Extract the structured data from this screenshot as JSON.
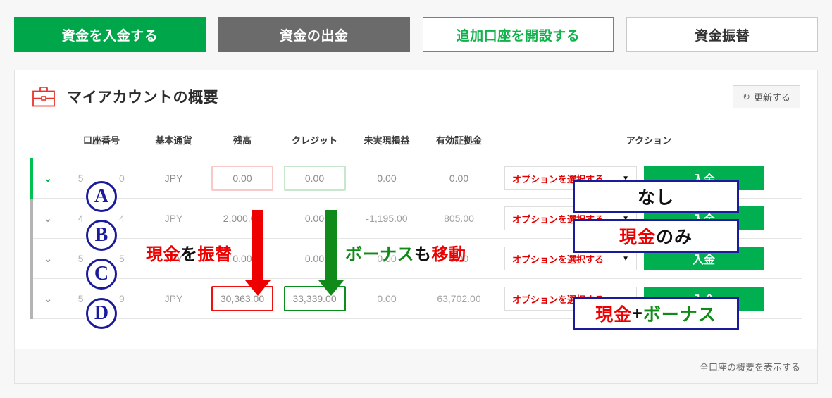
{
  "topbar": {
    "deposit_label": "資金を入金する",
    "withdraw_label": "資金の出金",
    "new_account_label": "追加口座を開設する",
    "transfer_label": "資金振替"
  },
  "card": {
    "icon": "briefcase-icon",
    "title": "マイアカウントの概要",
    "refresh_icon": "↻",
    "refresh_label": "更新する",
    "footer_link": "全口座の概要を表示する"
  },
  "table": {
    "headers": {
      "mark": "",
      "account": "口座番号",
      "currency": "基本通貨",
      "balance": "残高",
      "credit": "クレジット",
      "unrealized": "未実現損益",
      "equity": "有効証拠金",
      "action": "アクション"
    },
    "rows": [
      {
        "marker": "A",
        "chevron": "⌄",
        "account_prefix": "5",
        "account_suffix": "0",
        "currency": "JPY",
        "balance": "0.00",
        "credit": "0.00",
        "unrealized": "0.00",
        "equity": "0.00",
        "option_label": "オプションを選択する",
        "caret": "▼",
        "deposit_label": "入金"
      },
      {
        "marker": "B",
        "chevron": "⌄",
        "account_prefix": "4",
        "account_suffix": "4",
        "currency": "JPY",
        "balance": "2,000.00",
        "credit": "0.00",
        "unrealized": "-1,195.00",
        "equity": "805.00",
        "option_label": "オプションを選択する",
        "caret": "▼",
        "deposit_label": "入金"
      },
      {
        "marker": "C",
        "chevron": "⌄",
        "account_prefix": "5",
        "account_suffix": "5",
        "currency": "JPY",
        "balance": "0.00",
        "credit": "0.00",
        "unrealized": "0.00",
        "equity": "0.00",
        "option_label": "オプションを選択する",
        "caret": "▼",
        "deposit_label": "入金"
      },
      {
        "marker": "D",
        "chevron": "⌄",
        "account_prefix": "5",
        "account_suffix": "9",
        "currency": "JPY",
        "balance": "30,363.00",
        "credit": "33,339.00",
        "unrealized": "0.00",
        "equity": "63,702.00",
        "option_label": "オプションを選択する",
        "caret": "▼",
        "deposit_label": "入金"
      }
    ]
  },
  "annotations": {
    "markers": [
      "A",
      "B",
      "C",
      "D"
    ],
    "note_a": {
      "text": "なし"
    },
    "note_b": {
      "part1": "現金",
      "part2": "のみ"
    },
    "note_d": {
      "part1": "現金",
      "part2": " + ",
      "part3": "ボーナス"
    },
    "caption_cash": {
      "part1": "現金",
      "part2": "を",
      "part3": "振替"
    },
    "caption_bonus": {
      "part1": "ボーナス",
      "part2": "も",
      "part3": "移動"
    },
    "colors": {
      "red": "#ee0000",
      "green": "#108a18",
      "blue": "#1a1a9c",
      "brand_green": "#00a74a"
    }
  }
}
